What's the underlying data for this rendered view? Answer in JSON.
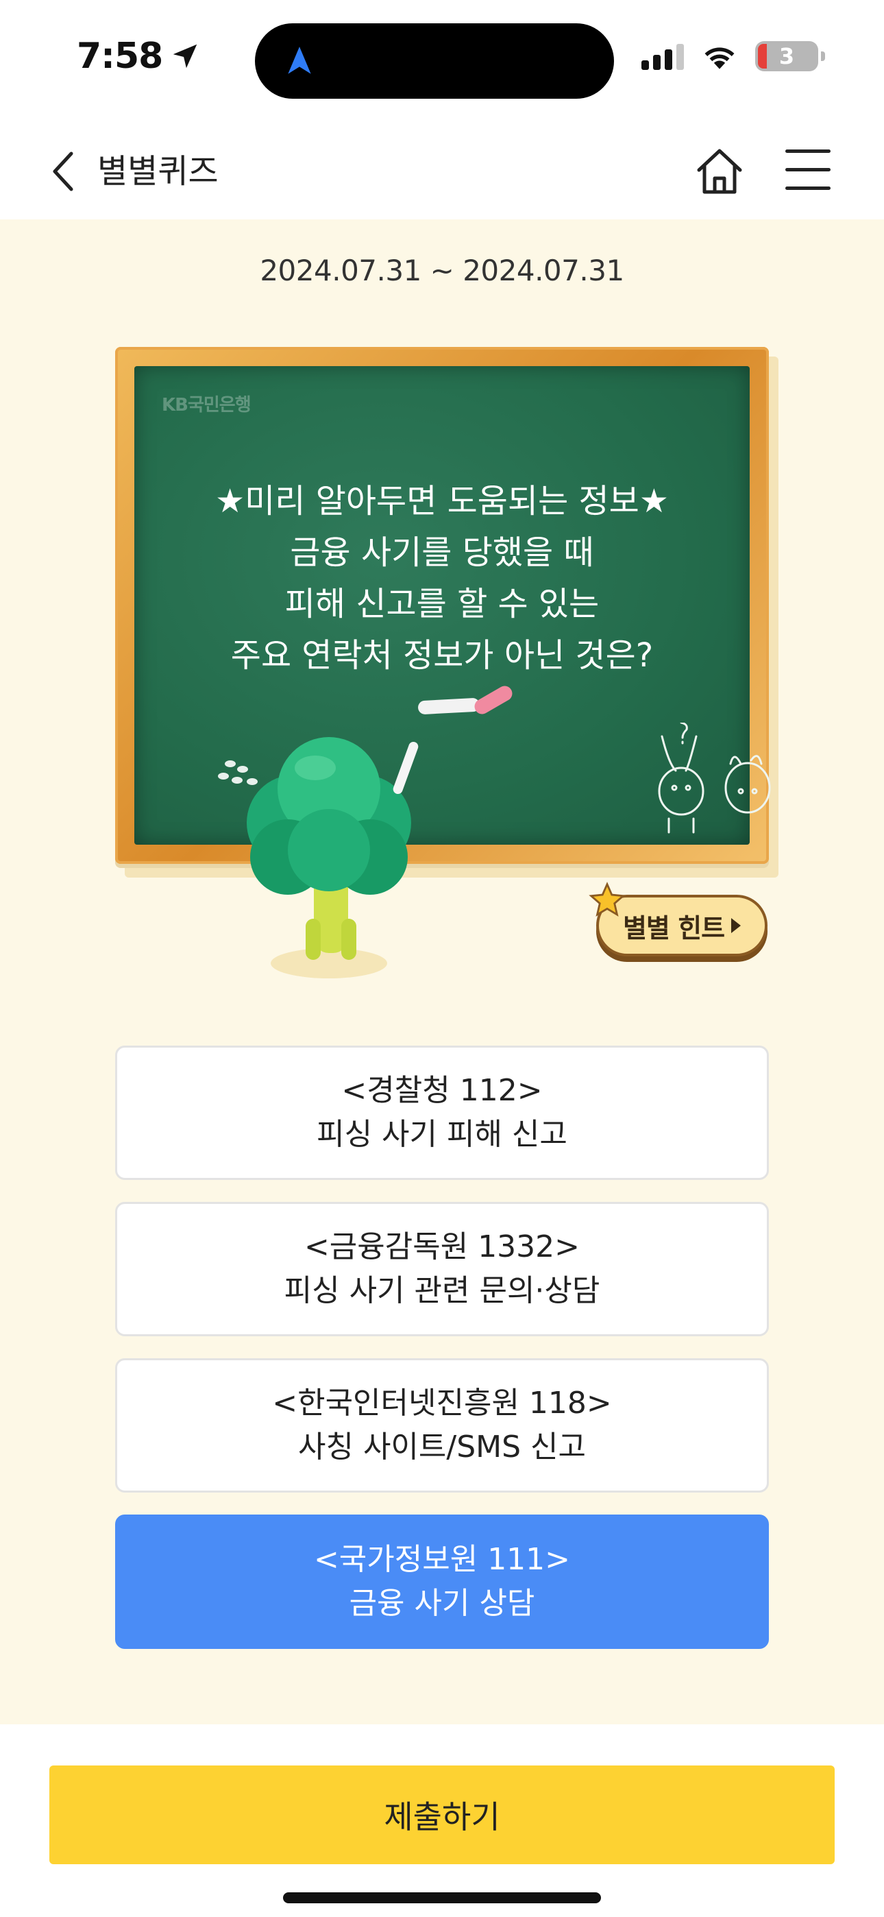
{
  "status_bar": {
    "time": "7:58",
    "battery_level": "3"
  },
  "nav": {
    "title": "별별퀴즈"
  },
  "quiz": {
    "date_range": "2024.07.31 ~ 2024.07.31",
    "board_logo": "KB국민은행",
    "question_lines": [
      "★미리 알아두면 도움되는 정보★",
      "금융 사기를 당했을 때",
      "피해 신고를 할 수 있는",
      "주요 연락처 정보가 아닌 것은?"
    ],
    "hint_label": "별별 힌트",
    "options": [
      {
        "title": "<경찰청 112>",
        "desc": "피싱 사기 피해 신고",
        "selected": false
      },
      {
        "title": "<금융감독원 1332>",
        "desc": "피싱 사기 관련 문의·상담",
        "selected": false
      },
      {
        "title": "<한국인터넷진흥원 118>",
        "desc": "사칭 사이트/SMS 신고",
        "selected": false
      },
      {
        "title": "<국가정보원 111>",
        "desc": "금융 사기 상담",
        "selected": true
      }
    ]
  },
  "footer": {
    "submit_label": "제출하기"
  },
  "colors": {
    "quiz_background": "#fdf8e6",
    "chalkboard": "#236b4b",
    "selected_option": "#4a8cf6",
    "submit_button": "#fdd232"
  }
}
